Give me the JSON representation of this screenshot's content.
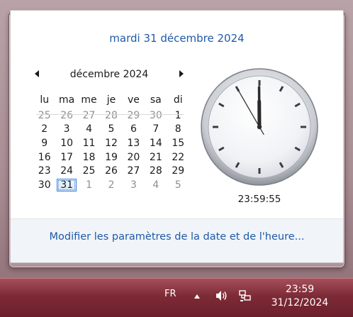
{
  "flyout": {
    "header_date": "mardi 31 décembre 2024",
    "calendar": {
      "month_title": "décembre 2024",
      "weekdays": [
        "lu",
        "ma",
        "me",
        "je",
        "ve",
        "sa",
        "di"
      ],
      "weeks": [
        [
          {
            "d": "25",
            "o": true
          },
          {
            "d": "26",
            "o": true
          },
          {
            "d": "27",
            "o": true
          },
          {
            "d": "28",
            "o": true
          },
          {
            "d": "29",
            "o": true
          },
          {
            "d": "30",
            "o": true
          },
          {
            "d": "1"
          }
        ],
        [
          {
            "d": "2"
          },
          {
            "d": "3"
          },
          {
            "d": "4"
          },
          {
            "d": "5"
          },
          {
            "d": "6"
          },
          {
            "d": "7"
          },
          {
            "d": "8"
          }
        ],
        [
          {
            "d": "9"
          },
          {
            "d": "10"
          },
          {
            "d": "11"
          },
          {
            "d": "12"
          },
          {
            "d": "13"
          },
          {
            "d": "14"
          },
          {
            "d": "15"
          }
        ],
        [
          {
            "d": "16"
          },
          {
            "d": "17"
          },
          {
            "d": "18"
          },
          {
            "d": "19"
          },
          {
            "d": "20"
          },
          {
            "d": "21"
          },
          {
            "d": "22"
          }
        ],
        [
          {
            "d": "23"
          },
          {
            "d": "24"
          },
          {
            "d": "25"
          },
          {
            "d": "26"
          },
          {
            "d": "27"
          },
          {
            "d": "28"
          },
          {
            "d": "29"
          }
        ],
        [
          {
            "d": "30"
          },
          {
            "d": "31",
            "t": true
          },
          {
            "d": "1",
            "o": true
          },
          {
            "d": "2",
            "o": true
          },
          {
            "d": "3",
            "o": true
          },
          {
            "d": "4",
            "o": true
          },
          {
            "d": "5",
            "o": true
          }
        ]
      ]
    },
    "clock": {
      "time": "23:59:55",
      "hours": 23,
      "minutes": 59,
      "seconds": 55
    },
    "change_link": "Modifier les paramètres de la date et de l'heure..."
  },
  "taskbar": {
    "language": "FR",
    "icons": [
      "show-hidden-icons-arrow",
      "speaker-icon",
      "network-icon"
    ],
    "time": "23:59",
    "date": "31/12/2024"
  },
  "colors": {
    "link": "#1e5aa8",
    "taskbar": "#7d2b36",
    "today_highlight": "#3c7fd4"
  }
}
